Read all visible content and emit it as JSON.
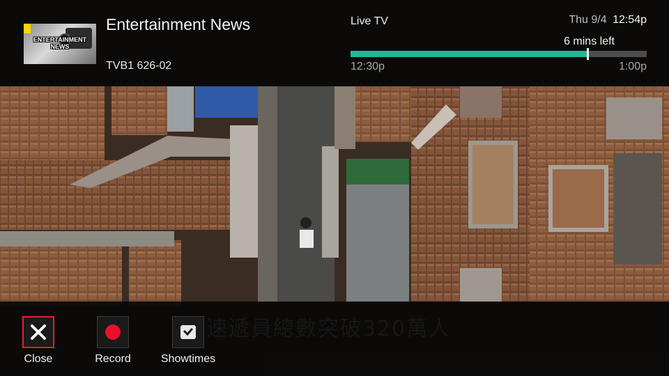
{
  "program": {
    "title": "Entertainment News",
    "channel": "TVB1 626-02",
    "thumbnail_text": "ENTERTAINMENT NEWS"
  },
  "status": {
    "mode": "Live TV",
    "date": "Thu 9/4",
    "time": "12:54p",
    "remaining": "6 mins left",
    "start_time": "12:30p",
    "end_time": "1:00p",
    "progress": 0.8
  },
  "video": {
    "burned_subtitle": "速遞員總數突破320萬人"
  },
  "actions": [
    {
      "label": "Close",
      "icon": "close-icon",
      "selected": true
    },
    {
      "label": "Record",
      "icon": "record-icon",
      "selected": false
    },
    {
      "label": "Showtimes",
      "icon": "clock-icon",
      "selected": false
    }
  ],
  "colors": {
    "progress_fill": "#1fb89a",
    "progress_track": "#4d4d4d",
    "selection_border": "#e0202e",
    "record_dot": "#e8102a",
    "bar_background": "#080808"
  }
}
